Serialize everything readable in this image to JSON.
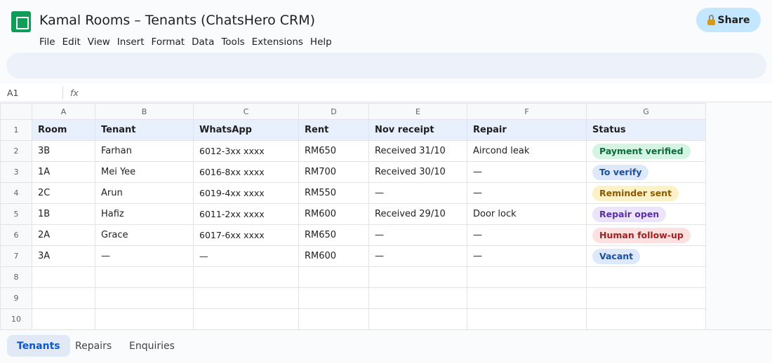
{
  "header": {
    "title": "Kamal Rooms – Tenants (ChatsHero CRM)",
    "share_label": "Share",
    "menu": [
      "File",
      "Edit",
      "View",
      "Insert",
      "Format",
      "Data",
      "Tools",
      "Extensions",
      "Help"
    ]
  },
  "formula_bar": {
    "cell_ref": "A1",
    "fx_label": "fx"
  },
  "grid": {
    "column_letters": [
      "A",
      "B",
      "C",
      "D",
      "E",
      "F",
      "G"
    ],
    "row_numbers": [
      "1",
      "2",
      "3",
      "4",
      "5",
      "6",
      "7",
      "8",
      "9",
      "10"
    ],
    "headers": [
      "Room",
      "Tenant",
      "WhatsApp",
      "Rent",
      "Nov receipt",
      "Repair",
      "Status"
    ],
    "rows": [
      [
        "3B",
        "Farhan",
        "6012-3xx xxxx",
        "RM650",
        "Received 31/10",
        "Aircond leak",
        "Payment verified"
      ],
      [
        "1A",
        "Mei Yee",
        "6016-8xx xxxx",
        "RM700",
        "Received 30/10",
        "—",
        "To verify"
      ],
      [
        "2C",
        "Arun",
        "6019-4xx xxxx",
        "RM550",
        "—",
        "—",
        "Reminder sent"
      ],
      [
        "1B",
        "Hafiz",
        "6011-2xx xxxx",
        "RM600",
        "Received 29/10",
        "Door lock",
        "Repair open"
      ],
      [
        "2A",
        "Grace",
        "6017-6xx xxxx",
        "RM650",
        "—",
        "—",
        "Human follow-up"
      ],
      [
        "3A",
        "—",
        "—",
        "RM600",
        "—",
        "—",
        "Vacant"
      ]
    ],
    "status_colors": {
      "Payment verified": {
        "bg": "#d4f5e3",
        "fg": "#0b6b3a"
      },
      "To verify": {
        "bg": "#dde8fb",
        "fg": "#1a4fa0"
      },
      "Reminder sent": {
        "bg": "#fdf1c7",
        "fg": "#8a5a00"
      },
      "Repair open": {
        "bg": "#ece4fb",
        "fg": "#5b2ea6"
      },
      "Human follow-up": {
        "bg": "#fde1e1",
        "fg": "#a32020"
      },
      "Vacant": {
        "bg": "#dde8fb",
        "fg": "#1a4fa0"
      }
    }
  },
  "sheet_tabs": [
    {
      "label": "Tenants",
      "active": true
    },
    {
      "label": "Repairs",
      "active": false
    },
    {
      "label": "Enquiries",
      "active": false
    }
  ],
  "colors": {
    "logo": "#0f9d58",
    "share_button": "#c2e7ff",
    "header_row": "#e8f0fe",
    "active_tab": "#0b57d0"
  }
}
